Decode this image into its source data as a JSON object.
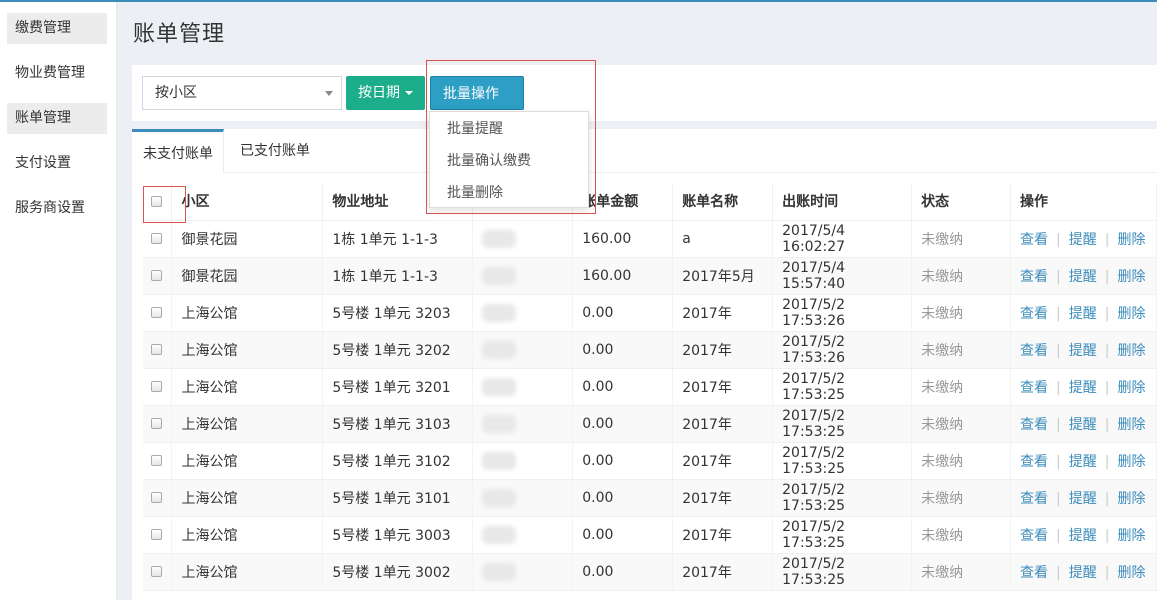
{
  "sidebar": {
    "items": [
      {
        "label": "缴费管理"
      },
      {
        "label": "物业费管理"
      },
      {
        "label": "账单管理"
      },
      {
        "label": "支付设置"
      },
      {
        "label": "服务商设置"
      }
    ]
  },
  "header": {
    "title": "账单管理"
  },
  "toolbar": {
    "community_select": "按小区",
    "date_button": "按日期",
    "batch_button": "批量操作"
  },
  "batch_menu": {
    "items": [
      "批量提醒",
      "批量确认缴费",
      "批量删除"
    ]
  },
  "tabs": [
    "未支付账单",
    "已支付账单"
  ],
  "table": {
    "headers": [
      "小区",
      "物业地址",
      "",
      "账单金额",
      "账单名称",
      "出账时间",
      "状态",
      "操作"
    ],
    "rows": [
      {
        "community": "御景花园",
        "address": "1栋 1单元 1-1-3",
        "amount": "160.00",
        "name": "a",
        "time": "2017/5/4 16:02:27",
        "status": "未缴纳"
      },
      {
        "community": "御景花园",
        "address": "1栋 1单元 1-1-3",
        "amount": "160.00",
        "name": "2017年5月",
        "time": "2017/5/4 15:57:40",
        "status": "未缴纳"
      },
      {
        "community": "上海公馆",
        "address": "5号楼 1单元 3203",
        "amount": "0.00",
        "name": "2017年",
        "time": "2017/5/2 17:53:26",
        "status": "未缴纳"
      },
      {
        "community": "上海公馆",
        "address": "5号楼 1单元 3202",
        "amount": "0.00",
        "name": "2017年",
        "time": "2017/5/2 17:53:26",
        "status": "未缴纳"
      },
      {
        "community": "上海公馆",
        "address": "5号楼 1单元 3201",
        "amount": "0.00",
        "name": "2017年",
        "time": "2017/5/2 17:53:25",
        "status": "未缴纳"
      },
      {
        "community": "上海公馆",
        "address": "5号楼 1单元 3103",
        "amount": "0.00",
        "name": "2017年",
        "time": "2017/5/2 17:53:25",
        "status": "未缴纳"
      },
      {
        "community": "上海公馆",
        "address": "5号楼 1单元 3102",
        "amount": "0.00",
        "name": "2017年",
        "time": "2017/5/2 17:53:25",
        "status": "未缴纳"
      },
      {
        "community": "上海公馆",
        "address": "5号楼 1单元 3101",
        "amount": "0.00",
        "name": "2017年",
        "time": "2017/5/2 17:53:25",
        "status": "未缴纳"
      },
      {
        "community": "上海公馆",
        "address": "5号楼 1单元 3003",
        "amount": "0.00",
        "name": "2017年",
        "time": "2017/5/2 17:53:25",
        "status": "未缴纳"
      },
      {
        "community": "上海公馆",
        "address": "5号楼 1单元 3002",
        "amount": "0.00",
        "name": "2017年",
        "time": "2017/5/2 17:53:25",
        "status": "未缴纳"
      }
    ],
    "actions": [
      "查看",
      "提醒",
      "删除"
    ]
  },
  "colors": {
    "accent": "#3c8dbc",
    "date_button": "#1cae8a",
    "batch_button": "#2d9fc4",
    "highlight": "#d9534f"
  }
}
